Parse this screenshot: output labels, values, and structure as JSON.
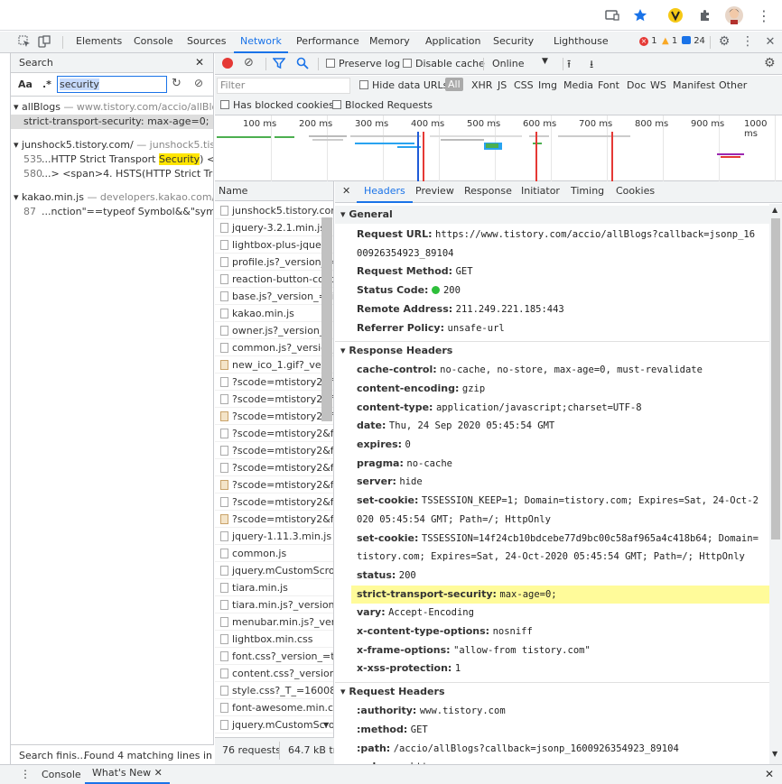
{
  "browser": {
    "icons": [
      "cast-icon",
      "star-icon",
      "extension-v-icon",
      "puzzle-icon",
      "profile-avatar",
      "more-icon"
    ]
  },
  "devtools_tabs": [
    "Elements",
    "Console",
    "Sources",
    "Network",
    "Performance",
    "Memory",
    "Application",
    "Security",
    "Lighthouse"
  ],
  "active_tab": "Network",
  "status": {
    "errors": "1",
    "warnings": "1",
    "messages": "24"
  },
  "search": {
    "title": "Search",
    "case_label": "Aa",
    "regex_label": ".*",
    "query": "security",
    "groups": [
      {
        "name": "allBlogs",
        "url": "— www.tistory.com/accio/allBlog...",
        "lines": [
          {
            "num": "",
            "text": "strict-transport-security:  max-age=0;"
          }
        ]
      },
      {
        "name": "junshock5.tistory.com/",
        "url": "— junshock5.tistor...",
        "lines": [
          {
            "num": "535",
            "pre": "...HTTP Strict Transport ",
            "match": "Security",
            "post": ") </s..."
          },
          {
            "num": "580",
            "pre": "...> <span>4. HSTS(HTTP Strict Trans...",
            "match": "",
            "post": ""
          }
        ]
      },
      {
        "name": "kakao.min.js",
        "url": "— developers.kakao.com/sdk...",
        "lines": [
          {
            "num": "87",
            "pre": "...nction\"==typeof Symbol&&\"symbol...",
            "match": "",
            "post": ""
          }
        ]
      }
    ],
    "footer_left": "Search finis...",
    "footer_right": "Found 4 matching lines in ..."
  },
  "network_toolbar": {
    "preserve_log": "Preserve log",
    "disable_cache": "Disable cache",
    "throttle": "Online"
  },
  "filter": {
    "placeholder": "Filter",
    "hide_data_urls": "Hide data URLs",
    "types": [
      "All",
      "XHR",
      "JS",
      "CSS",
      "Img",
      "Media",
      "Font",
      "Doc",
      "WS",
      "Manifest",
      "Other"
    ],
    "has_blocked_cookies": "Has blocked cookies",
    "blocked_requests": "Blocked Requests"
  },
  "timeline": {
    "ticks": [
      "100 ms",
      "200 ms",
      "300 ms",
      "400 ms",
      "500 ms",
      "600 ms",
      "700 ms",
      "800 ms",
      "900 ms",
      "1000 ms"
    ]
  },
  "requests": {
    "header": "Name",
    "items": [
      {
        "name": "junshock5.tistory.com/",
        "icon": "doc"
      },
      {
        "name": "jquery-3.2.1.min.js",
        "icon": "doc"
      },
      {
        "name": "lightbox-plus-jquery.min.js",
        "icon": "doc"
      },
      {
        "name": "profile.js?_version_=",
        "icon": "doc"
      },
      {
        "name": "reaction-button-container.min.js",
        "icon": "doc"
      },
      {
        "name": "base.js?_version_=tistory",
        "icon": "doc"
      },
      {
        "name": "kakao.min.js",
        "icon": "doc"
      },
      {
        "name": "owner.js?_version_=",
        "icon": "doc"
      },
      {
        "name": "common.js?_version_",
        "icon": "doc"
      },
      {
        "name": "new_ico_1.gif?_version_",
        "icon": "img"
      },
      {
        "name": "?scode=mtistory2&fname",
        "icon": "doc"
      },
      {
        "name": "?scode=mtistory2&fname",
        "icon": "doc"
      },
      {
        "name": "?scode=mtistory2&fname",
        "icon": "img"
      },
      {
        "name": "?scode=mtistory2&fname",
        "icon": "doc"
      },
      {
        "name": "?scode=mtistory2&fname",
        "icon": "doc"
      },
      {
        "name": "?scode=mtistory2&fname",
        "icon": "doc"
      },
      {
        "name": "?scode=mtistory2&fname",
        "icon": "img"
      },
      {
        "name": "?scode=mtistory2&fname",
        "icon": "doc"
      },
      {
        "name": "?scode=mtistory2&fname",
        "icon": "img"
      },
      {
        "name": "jquery-1.11.3.min.js",
        "icon": "doc"
      },
      {
        "name": "common.js",
        "icon": "doc"
      },
      {
        "name": "jquery.mCustomScrollbar",
        "icon": "doc"
      },
      {
        "name": "tiara.min.js",
        "icon": "doc"
      },
      {
        "name": "tiara.min.js?_version_",
        "icon": "doc"
      },
      {
        "name": "menubar.min.js?_version_",
        "icon": "doc"
      },
      {
        "name": "lightbox.min.css",
        "icon": "doc"
      },
      {
        "name": "font.css?_version_=tistory",
        "icon": "doc"
      },
      {
        "name": "content.css?_version_",
        "icon": "doc"
      },
      {
        "name": "style.css?_T_=1600829",
        "icon": "doc"
      },
      {
        "name": "font-awesome.min.css",
        "icon": "doc"
      },
      {
        "name": "jquery.mCustomScrollbar",
        "icon": "doc"
      }
    ],
    "count": "76 requests",
    "size": "64.7 kB tra"
  },
  "detail_tabs": [
    "Headers",
    "Preview",
    "Response",
    "Initiator",
    "Timing",
    "Cookies"
  ],
  "general": {
    "title": "General",
    "rows": [
      {
        "k": "Request URL:",
        "v": "https://www.tistory.com/accio/allBlogs?callback=jsonp_1600926354923_89104"
      },
      {
        "k": "Request Method:",
        "v": "GET"
      },
      {
        "k": "Status Code:",
        "v": "200"
      },
      {
        "k": "Remote Address:",
        "v": "211.249.221.185:443"
      },
      {
        "k": "Referrer Policy:",
        "v": "unsafe-url"
      }
    ]
  },
  "response_headers": {
    "title": "Response Headers",
    "rows": [
      {
        "k": "cache-control:",
        "v": "no-cache, no-store, max-age=0, must-revalidate"
      },
      {
        "k": "content-encoding:",
        "v": "gzip"
      },
      {
        "k": "content-type:",
        "v": "application/javascript;charset=UTF-8"
      },
      {
        "k": "date:",
        "v": "Thu, 24 Sep 2020 05:45:54 GMT"
      },
      {
        "k": "expires:",
        "v": "0"
      },
      {
        "k": "pragma:",
        "v": "no-cache"
      },
      {
        "k": "server:",
        "v": "hide"
      },
      {
        "k": "set-cookie:",
        "v": "TSSESSION_KEEP=1; Domain=tistory.com; Expires=Sat, 24-Oct-2020 05:45:54 GMT; Path=/; HttpOnly"
      },
      {
        "k": "set-cookie:",
        "v": "TSSESSION=14f24cb10bdcebe77d9bc00c58af965a4c418b64; Domain=tistory.com; Expires=Sat, 24-Oct-2020 05:45:54 GMT; Path=/; HttpOnly"
      },
      {
        "k": "status:",
        "v": "200"
      },
      {
        "k": "strict-transport-security:",
        "v": "max-age=0;",
        "highlight": true
      },
      {
        "k": "vary:",
        "v": "Accept-Encoding"
      },
      {
        "k": "x-content-type-options:",
        "v": "nosniff"
      },
      {
        "k": "x-frame-options:",
        "v": "\"allow-from tistory.com\""
      },
      {
        "k": "x-xss-protection:",
        "v": "1"
      }
    ]
  },
  "request_headers": {
    "title": "Request Headers",
    "rows": [
      {
        "k": ":authority:",
        "v": "www.tistory.com"
      },
      {
        "k": ":method:",
        "v": "GET"
      },
      {
        "k": ":path:",
        "v": "/accio/allBlogs?callback=jsonp_1600926354923_89104"
      },
      {
        "k": ":scheme:",
        "v": "https"
      }
    ]
  },
  "drawer": {
    "tabs": [
      "Console",
      "What's New"
    ]
  }
}
